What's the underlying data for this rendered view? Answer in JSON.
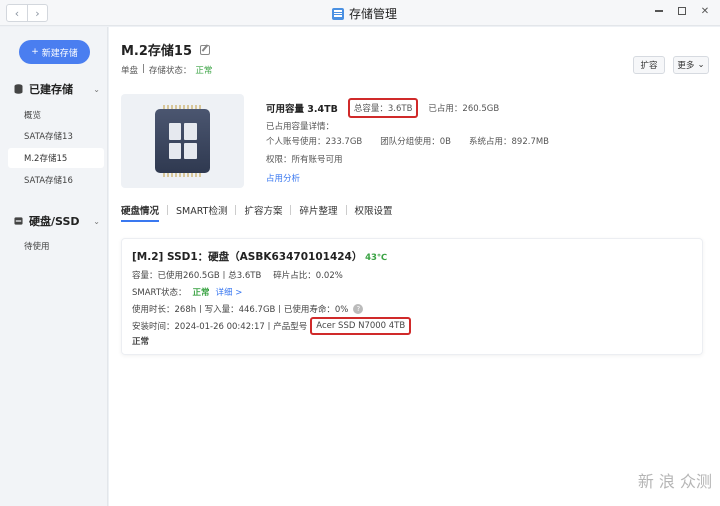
{
  "window": {
    "title": "存储管理"
  },
  "sidebar": {
    "new_button": "新建存储",
    "section_storage": "已建存储",
    "storage_items": [
      "概览",
      "SATA存储13",
      "M.2存储15",
      "SATA存储16"
    ],
    "section_disks": "硬盘/SSD",
    "disk_items": [
      "待使用"
    ]
  },
  "header": {
    "title": "M.2存储15",
    "type": "单盘",
    "status_label": "存储状态：",
    "status_value": "正常",
    "expand_button": "扩容",
    "more_button": "更多"
  },
  "summary": {
    "available": "可用容量 3.4TB",
    "total": "总容量：3.6TB",
    "used": "已占用：260.5GB",
    "details_title": "已占用容量详情：",
    "personal": "个人账号使用：233.7GB",
    "team": "团队分组使用：0B",
    "system": "系统占用：892.7MB",
    "permission": "权限：所有账号可用",
    "analysis_link": "占用分析"
  },
  "tabs": [
    "硬盘情况",
    "SMART检测",
    "扩容方案",
    "碎片整理",
    "权限设置"
  ],
  "disk": {
    "title": "[M.2] SSD1：硬盘（ASBK63470101424）",
    "temp": "43℃",
    "capacity": "容量：已使用260.5GB丨总3.6TB",
    "fragment": "碎片占比：0.02%",
    "smart_label": "SMART状态：",
    "smart_value": "正常",
    "smart_link": "详细 >",
    "usage": "使用时长：268h丨写入量：446.7GB丨已使用寿命：0%",
    "install": "安装时间：2024-01-26 00:42:17丨产品型号",
    "model": "Acer SSD N7000 4TB",
    "state": "正常"
  },
  "watermark": "新 浪 众测",
  "colors": {
    "accent": "#4a7ef0",
    "ok": "#3aa343",
    "highlight": "#d02a2a"
  }
}
